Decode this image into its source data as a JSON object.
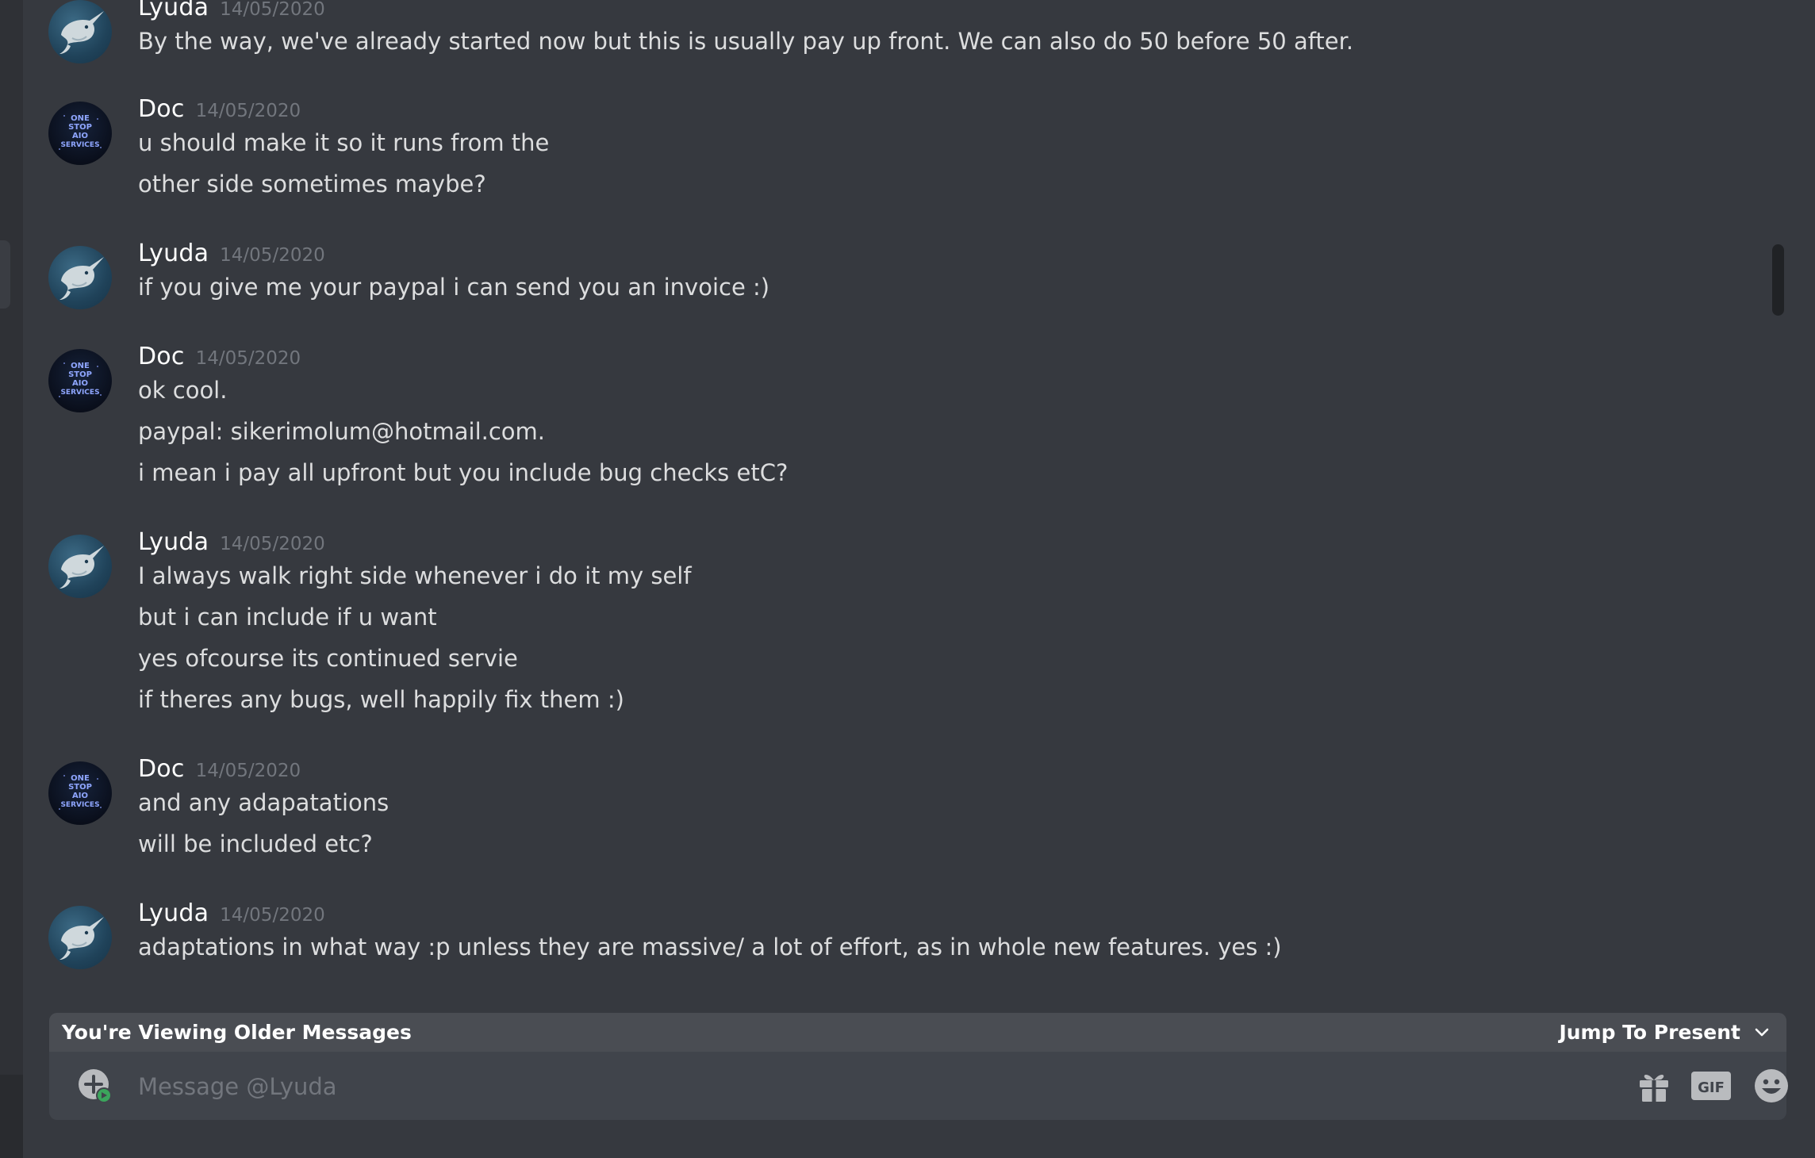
{
  "messages": [
    {
      "author": "Lyuda",
      "timestamp": "14/05/2020",
      "avatar": "lyuda",
      "lines": [
        "By the way, we've already started now but this is usually pay up front. We can also do 50 before 50 after."
      ]
    },
    {
      "author": "Doc",
      "timestamp": "14/05/2020",
      "avatar": "doc",
      "lines": [
        "u should make it so it runs from the",
        "other side sometimes maybe?"
      ]
    },
    {
      "author": "Lyuda",
      "timestamp": "14/05/2020",
      "avatar": "lyuda",
      "lines": [
        "if you give me your paypal i can send you an invoice :)"
      ]
    },
    {
      "author": "Doc",
      "timestamp": "14/05/2020",
      "avatar": "doc",
      "lines": [
        "ok cool.",
        "paypal: sikerimolum@hotmail.com.",
        "i mean i pay all upfront but you include bug checks etC?"
      ]
    },
    {
      "author": "Lyuda",
      "timestamp": "14/05/2020",
      "avatar": "lyuda",
      "lines": [
        "I always walk right side whenever i do it my self",
        "but i can include if u want",
        "yes ofcourse its continued servie",
        "if theres any bugs, well happily fix them :)"
      ]
    },
    {
      "author": "Doc",
      "timestamp": "14/05/2020",
      "avatar": "doc",
      "lines": [
        "and any adapatations",
        "will be included etc?"
      ]
    },
    {
      "author": "Lyuda",
      "timestamp": "14/05/2020",
      "avatar": "lyuda",
      "lines": [
        "adaptations in what way :p unless they are massive/ a lot of effort, as in whole new features. yes :)"
      ]
    }
  ],
  "older_bar": {
    "text": "You're Viewing Older Messages",
    "jump_label": "Jump To Present"
  },
  "composer": {
    "placeholder": "Message @Lyuda",
    "value": "",
    "icons": [
      "add-attachment-icon",
      "gift-icon",
      "gif-icon",
      "emoji-icon"
    ]
  },
  "avatar_text": {
    "doc": [
      "ONE",
      "STOP",
      "AIO",
      "SERVICES"
    ]
  },
  "colors": {
    "background": "#36393f",
    "author": "#ffffff",
    "timestamp": "#72767d",
    "message_text": "#dcddde",
    "composer": "#40444b",
    "older_bar": "#4a4d53"
  }
}
